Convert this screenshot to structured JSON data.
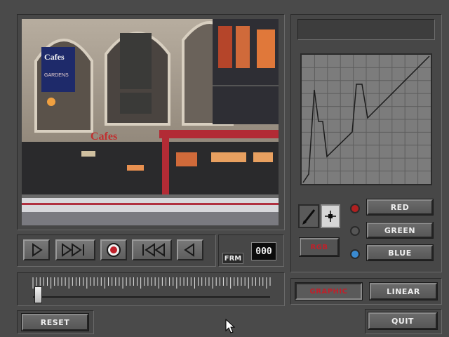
{
  "transport": {
    "frame_label": "FRM",
    "frame_counter": "000"
  },
  "controls": {
    "reset_label": "RESET",
    "quit_label": "QUIT"
  },
  "curve_editor": {
    "name_field": "",
    "rgb_label": "RGB",
    "channels": [
      {
        "label": "RED",
        "led_color": "#b02020"
      },
      {
        "label": "GREEN",
        "led_color": "#555555"
      },
      {
        "label": "BLUE",
        "led_color": "#3a8ad0"
      }
    ],
    "mode_graphic_label": "GRAPHIC",
    "mode_linear_label": "LINEAR"
  },
  "video": {
    "sign_top": "Cafes",
    "sign_sub": "GARDENS",
    "sign_lower": "Cafes"
  },
  "slider": {
    "position_fraction": 0.02
  },
  "colors": {
    "accent_red": "#c0202a",
    "background": "#4a4a4a"
  }
}
